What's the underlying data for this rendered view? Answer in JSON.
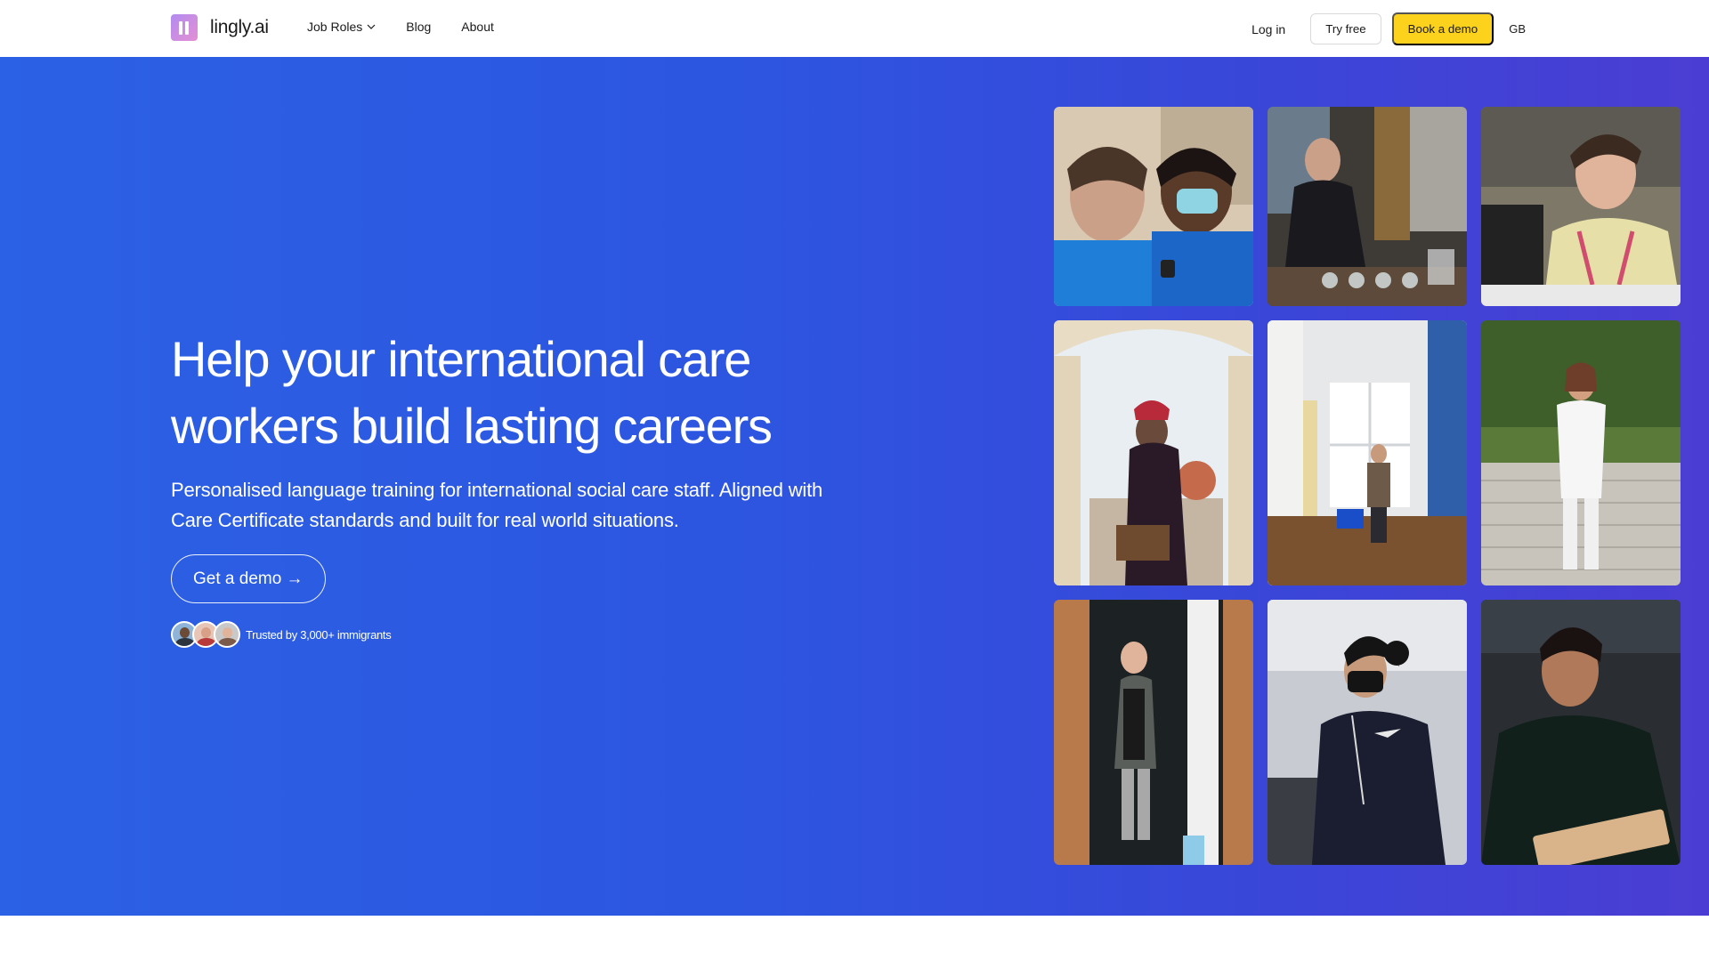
{
  "brand": {
    "name": "lingly.ai"
  },
  "nav": {
    "items": [
      {
        "label": "Job Roles",
        "has_dropdown": true
      },
      {
        "label": "Blog"
      },
      {
        "label": "About"
      }
    ]
  },
  "header_actions": {
    "login_label": "Log in",
    "try_free_label": "Try free",
    "book_demo_label": "Book a demo",
    "locale": "GB"
  },
  "hero": {
    "title": "Help your international care workers build lasting careers",
    "subtitle": "Personalised language training for international social care staff. Aligned with Care Certificate standards and built for real world situations.",
    "cta_label": "Get a demo →",
    "trust_text": "Trusted by 3,000+ immigrants"
  },
  "colors": {
    "hero_gradient_start": "#2b61e4",
    "hero_gradient_end": "#4b3dd3",
    "cta_yellow": "#fcd21c"
  }
}
